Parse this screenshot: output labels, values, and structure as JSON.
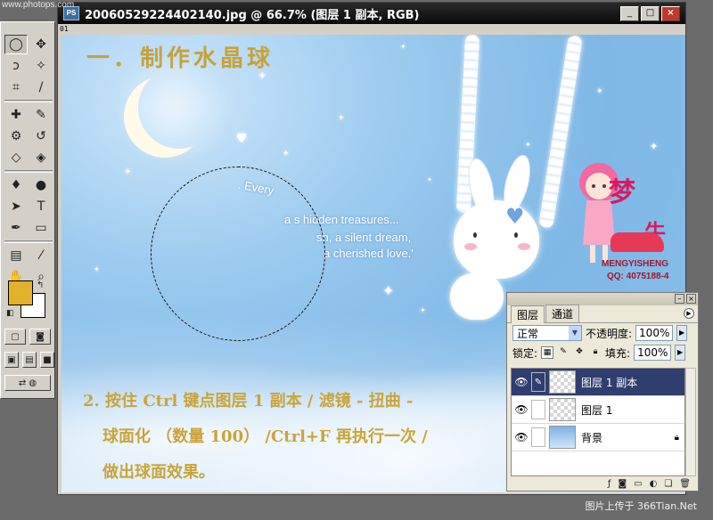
{
  "watermark_top": "www.photops.com",
  "watermark_bottom": "图片上传于 366Tian.Net",
  "document": {
    "title": "20060529224402140.jpg @ 66.7% (图层 1 副本, RGB)",
    "title_icon": "PS",
    "ruler_label": "01",
    "window_buttons": {
      "minimize": "_",
      "maximize": "□",
      "close": "×"
    }
  },
  "canvas": {
    "heading": "一．制作水晶球",
    "instructions": [
      "2. 按住 Ctrl 键点图层 1 副本 / 滤镜 - 扭曲 -",
      "球面化 （数量 100） /Ctrl+F 再执行一次 /",
      "做出球面效果。"
    ],
    "quote_lines": [
      ". Every",
      "a s  hidden treasures...",
      "sh, a silent dream,",
      "a cherished love.'"
    ],
    "logo": {
      "chars_1": "梦",
      "chars_2": "牛",
      "brand": "MENGYISHENG",
      "qq": "QQ: 4075188-4"
    }
  },
  "toolbox": {
    "tools": [
      {
        "name": "marquee-tool-icon",
        "glyph": "◯",
        "active": true
      },
      {
        "name": "move-tool-icon",
        "glyph": "✥"
      },
      {
        "name": "lasso-tool-icon",
        "glyph": "ↄ"
      },
      {
        "name": "magic-wand-tool-icon",
        "glyph": "✧"
      },
      {
        "name": "crop-tool-icon",
        "glyph": "⌗"
      },
      {
        "name": "slice-tool-icon",
        "glyph": "∕"
      },
      {
        "name": "healing-brush-tool-icon",
        "glyph": "✚"
      },
      {
        "name": "brush-tool-icon",
        "glyph": "✎"
      },
      {
        "name": "clone-stamp-tool-icon",
        "glyph": "⚙"
      },
      {
        "name": "history-brush-tool-icon",
        "glyph": "↺"
      },
      {
        "name": "eraser-tool-icon",
        "glyph": "◇"
      },
      {
        "name": "paint-bucket-tool-icon",
        "glyph": "◈"
      },
      {
        "name": "blur-tool-icon",
        "glyph": "♦"
      },
      {
        "name": "dodge-tool-icon",
        "glyph": "●"
      },
      {
        "name": "path-selection-tool-icon",
        "glyph": "➤"
      },
      {
        "name": "type-tool-icon",
        "glyph": "T"
      },
      {
        "name": "pen-tool-icon",
        "glyph": "✒"
      },
      {
        "name": "rectangle-tool-icon",
        "glyph": "▭"
      },
      {
        "name": "notes-tool-icon",
        "glyph": "▤"
      },
      {
        "name": "eyedropper-tool-icon",
        "glyph": "⁄"
      },
      {
        "name": "hand-tool-icon",
        "glyph": "✋"
      },
      {
        "name": "zoom-tool-icon",
        "glyph": "⌕"
      }
    ],
    "foreground_color": "#e1b22a",
    "background_color": "#ffffff"
  },
  "layers_panel": {
    "tabs": [
      "图层",
      "通道"
    ],
    "blend_mode": "正常",
    "opacity_label": "不透明度:",
    "opacity_value": "100%",
    "lock_label": "锁定:",
    "fill_label": "填充:",
    "fill_value": "100%",
    "layers": [
      {
        "name": "图层 1 副本",
        "selected": true,
        "locked": false
      },
      {
        "name": "图层 1",
        "selected": false,
        "locked": false
      },
      {
        "name": "背景",
        "selected": false,
        "locked": true
      }
    ]
  },
  "colors": {
    "heading_text": "#c7a23a",
    "selected_layer": "#2f3e6f",
    "title_bar": "#0a0a0a"
  }
}
